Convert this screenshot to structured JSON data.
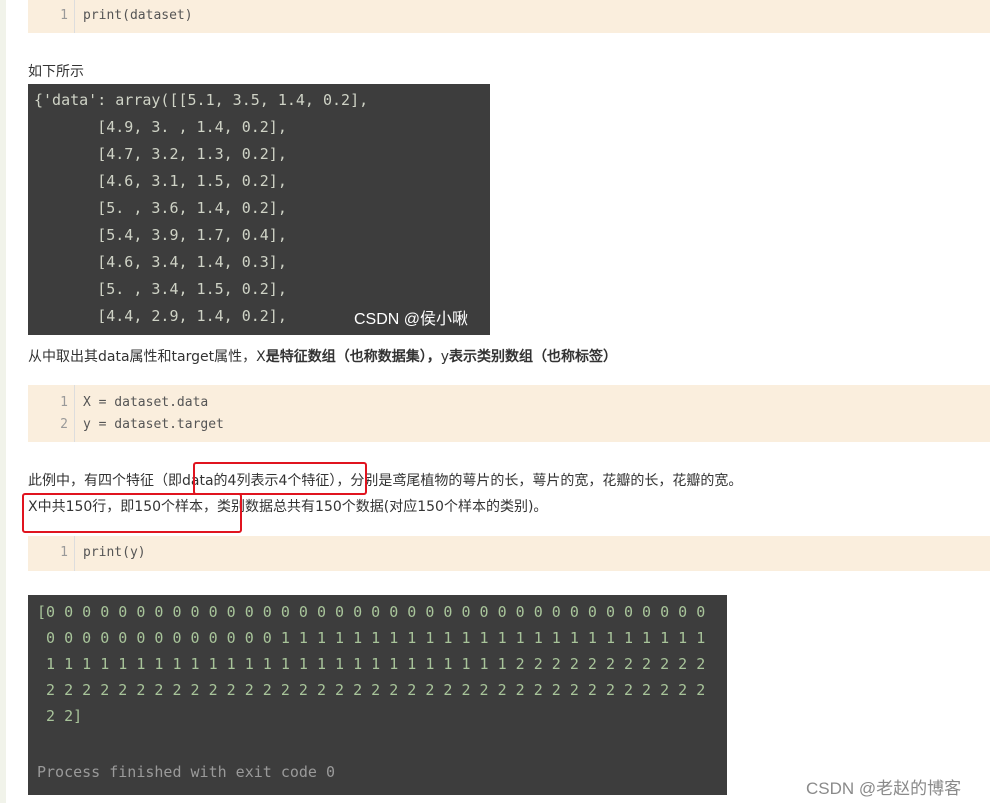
{
  "code_block_1": {
    "lines": [
      {
        "num": "1",
        "text": "print(dataset)"
      }
    ]
  },
  "text_1": "如下所示",
  "console_1": {
    "lines": [
      "{'data': array([[5.1, 3.5, 1.4, 0.2],",
      "       [4.9, 3. , 1.4, 0.2],",
      "       [4.7, 3.2, 1.3, 0.2],",
      "       [4.6, 3.1, 1.5, 0.2],",
      "       [5. , 3.6, 1.4, 0.2],",
      "       [5.4, 3.9, 1.7, 0.4],",
      "       [4.6, 3.4, 1.4, 0.3],",
      "       [5. , 3.4, 1.5, 0.2],",
      "       [4.4, 2.9, 1.4, 0.2],"
    ],
    "watermark": "CSDN @侯小啾"
  },
  "text_2": {
    "part1": "从中取出其data属性和target属性，X",
    "bold1": "是特征数组（也称数据集），",
    "part2": "y",
    "bold2": "表示类别数组（也称标签）"
  },
  "code_block_2": {
    "lines": [
      {
        "num": "1",
        "text": "X = dataset.data"
      },
      {
        "num": "2",
        "text": "y = dataset.target"
      }
    ]
  },
  "text_3": {
    "line1": "此例中，有四个特征（即data的4列表示4个特征），分别是鸢尾植物的萼片的长，萼片的宽，花瓣的长，花瓣的宽。",
    "line2": "X中共150行，即150个样本，类别数据总共有150个数据(对应150个样本的类别)。"
  },
  "code_block_3": {
    "lines": [
      {
        "num": "1",
        "text": "print(y)"
      }
    ]
  },
  "console_2": {
    "rows": [
      "[0 0 0 0 0 0 0 0 0 0 0 0 0 0 0 0 0 0 0 0 0 0 0 0 0 0 0 0 0 0 0 0 0 0 0 0 0",
      " 0 0 0 0 0 0 0 0 0 0 0 0 0 1 1 1 1 1 1 1 1 1 1 1 1 1 1 1 1 1 1 1 1 1 1 1 1",
      " 1 1 1 1 1 1 1 1 1 1 1 1 1 1 1 1 1 1 1 1 1 1 1 1 1 1 2 2 2 2 2 2 2 2 2 2 2",
      " 2 2 2 2 2 2 2 2 2 2 2 2 2 2 2 2 2 2 2 2 2 2 2 2 2 2 2 2 2 2 2 2 2 2 2 2 2",
      " 2 2]"
    ],
    "status": "Process finished with exit code 0"
  },
  "watermark_2": "CSDN @老赵的博客"
}
